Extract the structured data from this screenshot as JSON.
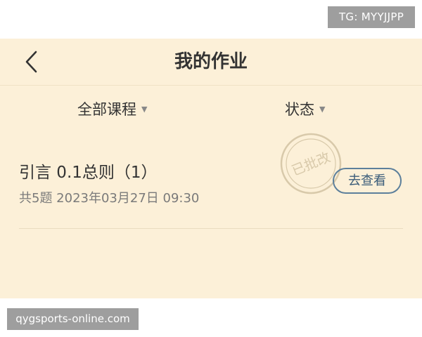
{
  "watermarks": {
    "top": "TG: MYYJJPP",
    "bottom": "qygsports-online.com"
  },
  "header": {
    "title": "我的作业",
    "back_icon": "chevron-left-icon"
  },
  "filters": {
    "course": {
      "label": "全部课程",
      "arrow": "▼"
    },
    "status": {
      "label": "状态",
      "arrow": "▼"
    }
  },
  "assignments": [
    {
      "title": "引言 0.1总则（1）",
      "meta": "共5题 2023年03月27日  09:30",
      "stamp": "已批改",
      "action_label": "去查看"
    }
  ],
  "colors": {
    "background": "#fcf0d8",
    "title_text": "#333333",
    "meta_text": "#7a7a7a",
    "button_border": "#5c7f9b",
    "stamp": "#d8c9aa"
  }
}
